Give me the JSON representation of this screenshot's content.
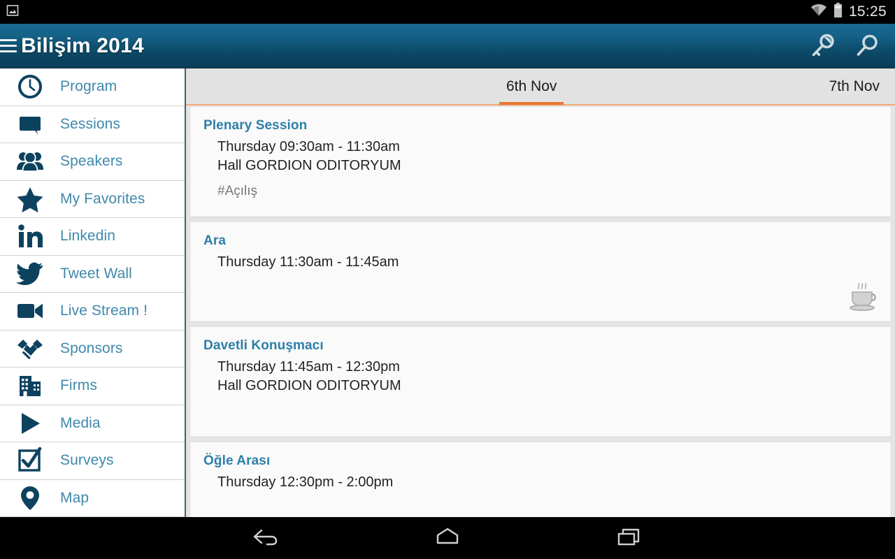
{
  "statusbar": {
    "notification_icon": "screenshot-image-icon",
    "wifi_icon": "wifi-icon",
    "battery_icon": "battery-icon",
    "clock": "15:25"
  },
  "actionbar": {
    "menu_icon": "hamburger-menu-icon",
    "title": "Bilişim 2014",
    "actions": [
      {
        "name": "key-icon",
        "label": "Login"
      },
      {
        "name": "search-icon",
        "label": "Search"
      }
    ]
  },
  "sidebar": {
    "items": [
      {
        "label": "Program",
        "icon": "clock-icon"
      },
      {
        "label": "Sessions",
        "icon": "speech-bubble-icon"
      },
      {
        "label": "Speakers",
        "icon": "people-icon"
      },
      {
        "label": "My Favorites",
        "icon": "star-icon"
      },
      {
        "label": "Linkedin",
        "icon": "linkedin-icon"
      },
      {
        "label": "Tweet Wall",
        "icon": "twitter-bird-icon"
      },
      {
        "label": "Live Stream !",
        "icon": "video-camera-icon"
      },
      {
        "label": "Sponsors",
        "icon": "handshake-icon"
      },
      {
        "label": "Firms",
        "icon": "building-icon"
      },
      {
        "label": "Media",
        "icon": "play-icon"
      },
      {
        "label": "Surveys",
        "icon": "checkbox-checked-icon"
      },
      {
        "label": "Map",
        "icon": "location-pin-icon"
      }
    ]
  },
  "content": {
    "tabs": [
      {
        "label": "6th Nov",
        "active": true
      },
      {
        "label": "7th Nov",
        "active": false
      }
    ],
    "sessions": [
      {
        "title": "Plenary Session",
        "time": "Thursday 09:30am - 11:30am",
        "hall": "Hall GORDION ODITORYUM",
        "tag": "#Açılış",
        "badge": null
      },
      {
        "title": "Ara",
        "time": "Thursday 11:30am - 11:45am",
        "hall": null,
        "tag": null,
        "badge": "coffee-cup-icon"
      },
      {
        "title": "Davetli Konuşmacı",
        "time": "Thursday 11:45am - 12:30pm",
        "hall": "Hall GORDION ODITORYUM",
        "tag": null,
        "badge": null
      },
      {
        "title": "Öğle Arası",
        "time": "Thursday 12:30pm - 2:00pm",
        "hall": null,
        "tag": null,
        "badge": null
      }
    ]
  },
  "navbar": {
    "buttons": [
      {
        "name": "back-button",
        "icon": "back-arrow-icon"
      },
      {
        "name": "home-button",
        "icon": "home-icon"
      },
      {
        "name": "recents-button",
        "icon": "recent-apps-icon"
      }
    ]
  },
  "colors": {
    "accent_orange": "#e8772e",
    "brand_blue": "#156187",
    "link_blue": "#3f89ab",
    "title_blue": "#2d7fa8",
    "icon_navy": "#0d425f"
  }
}
